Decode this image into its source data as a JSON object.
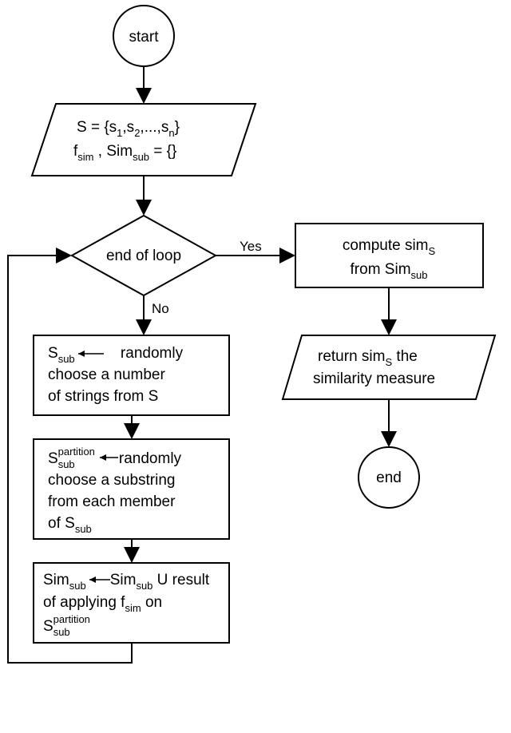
{
  "nodes": {
    "start": "start",
    "end": "end",
    "decision": "end of loop",
    "input_line1a": "S = {s",
    "input_line1b": ",s",
    "input_line1c": ",...,s",
    "input_line1d": "}",
    "input_sub1": "1",
    "input_sub2": "2",
    "input_sub3": "n",
    "input_line2a": "f",
    "input_line2b": " , Sim",
    "input_line2c": " = {}",
    "input_l2_sub1": "sim",
    "input_l2_sub2": "sub",
    "proc1_l1a": "S",
    "proc1_l1_sub": "sub",
    "proc1_l1b": "  randomly",
    "proc1_l2": "choose a number",
    "proc1_l3": "of strings from S",
    "proc2_l1a": "S",
    "proc2_l1_sub": "sub",
    "proc2_l1_sup": "partition",
    "proc2_l1b": "randomly",
    "proc2_l2": "choose a substring",
    "proc2_l3": "from each member",
    "proc2_l4a": "of S",
    "proc2_l4_sub": "sub",
    "proc3_l1a": "Sim",
    "proc3_l1_sub1": "sub",
    "proc3_l1b": "Sim",
    "proc3_l1_sub2": "sub",
    "proc3_l1c": " U result",
    "proc3_l2a": "of applying  f",
    "proc3_l2_sub": "sim",
    "proc3_l2b": " on",
    "proc3_l3a": "S",
    "proc3_l3_sub": "sub",
    "proc3_l3_sup": "partition",
    "compute_l1a": "compute sim",
    "compute_l1_sub": "S",
    "compute_l2a": "from Sim",
    "compute_l2_sub": "sub",
    "return_l1a": "return sim",
    "return_l1_sub": "S",
    "return_l1b": " the",
    "return_l2": "similarity measure"
  },
  "edges": {
    "yes": "Yes",
    "no": "No"
  },
  "chart_data": {
    "type": "flowchart",
    "nodes": [
      {
        "id": "start",
        "type": "terminator",
        "label": "start"
      },
      {
        "id": "input",
        "type": "io",
        "label": "S = {s_1, s_2, ..., s_n}; f_sim, Sim_sub = {}"
      },
      {
        "id": "decision",
        "type": "decision",
        "label": "end of loop"
      },
      {
        "id": "proc1",
        "type": "process",
        "label": "S_sub ← randomly choose a number of strings from S"
      },
      {
        "id": "proc2",
        "type": "process",
        "label": "S_sub^partition ← randomly choose a substring from each member of S_sub"
      },
      {
        "id": "proc3",
        "type": "process",
        "label": "Sim_sub ← Sim_sub ∪ result of applying f_sim on S_sub^partition"
      },
      {
        "id": "compute",
        "type": "process",
        "label": "compute sim_S from Sim_sub"
      },
      {
        "id": "return",
        "type": "io",
        "label": "return sim_S the similarity measure"
      },
      {
        "id": "end",
        "type": "terminator",
        "label": "end"
      }
    ],
    "edges": [
      {
        "from": "start",
        "to": "input"
      },
      {
        "from": "input",
        "to": "decision"
      },
      {
        "from": "decision",
        "to": "proc1",
        "label": "No"
      },
      {
        "from": "decision",
        "to": "compute",
        "label": "Yes"
      },
      {
        "from": "proc1",
        "to": "proc2"
      },
      {
        "from": "proc2",
        "to": "proc3"
      },
      {
        "from": "proc3",
        "to": "decision",
        "back": true
      },
      {
        "from": "compute",
        "to": "return"
      },
      {
        "from": "return",
        "to": "end"
      }
    ]
  }
}
